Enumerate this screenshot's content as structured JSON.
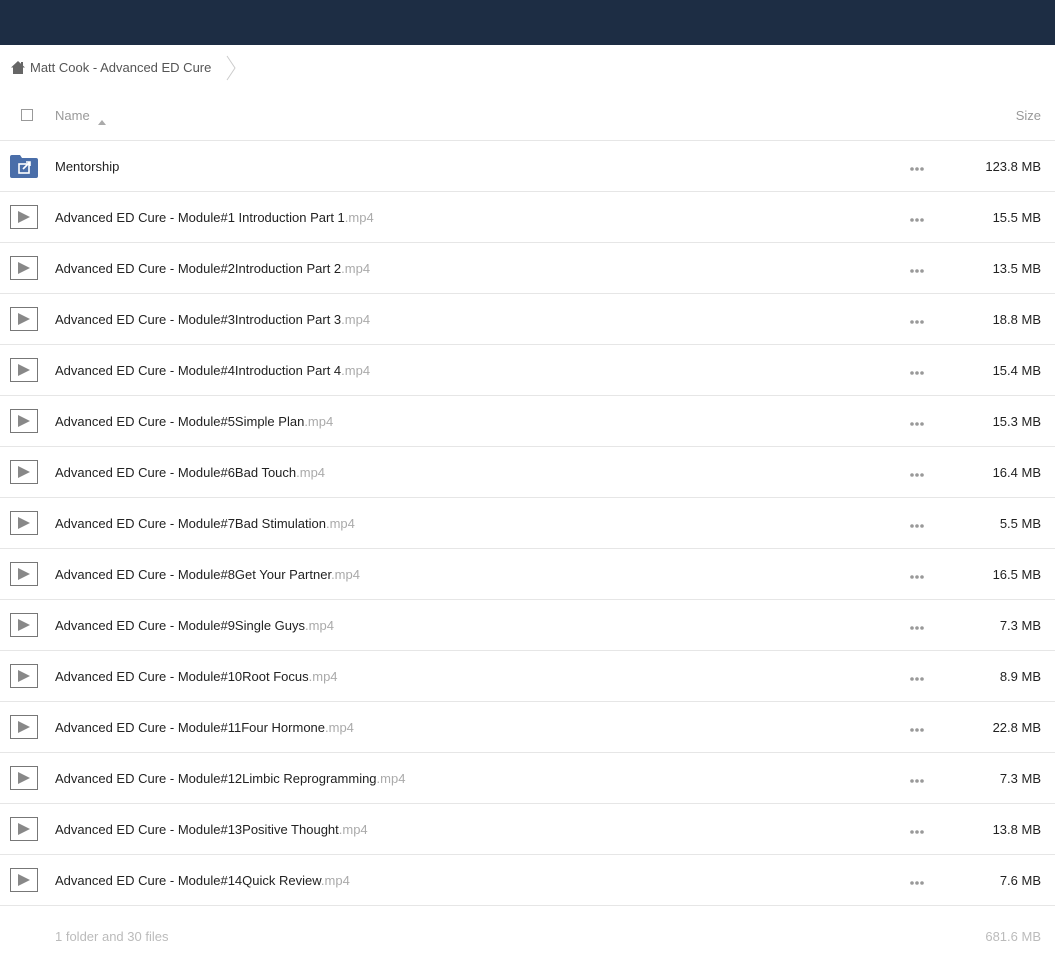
{
  "colors": {
    "topbar": "#1d2d44",
    "folder_icon": "#4a6ea9",
    "row_border": "#e6e6e6"
  },
  "breadcrumb": {
    "home_icon": "home-icon",
    "label": "Matt Cook - Advanced ED Cure"
  },
  "table": {
    "header": {
      "name": "Name",
      "size": "Size"
    },
    "rows": [
      {
        "type": "folder",
        "icon": "folder-shared-icon",
        "name": "Mentorship",
        "ext": "",
        "size": "123.8 MB"
      },
      {
        "type": "video",
        "icon": "video-icon",
        "name": "Advanced ED Cure - Module#1 Introduction Part 1",
        "ext": ".mp4",
        "size": "15.5 MB"
      },
      {
        "type": "video",
        "icon": "video-icon",
        "name": "Advanced ED Cure - Module#2Introduction Part 2",
        "ext": ".mp4",
        "size": "13.5 MB"
      },
      {
        "type": "video",
        "icon": "video-icon",
        "name": "Advanced ED Cure - Module#3Introduction Part 3",
        "ext": ".mp4",
        "size": "18.8 MB"
      },
      {
        "type": "video",
        "icon": "video-icon",
        "name": "Advanced ED Cure - Module#4Introduction Part 4",
        "ext": ".mp4",
        "size": "15.4 MB"
      },
      {
        "type": "video",
        "icon": "video-icon",
        "name": "Advanced ED Cure - Module#5Simple Plan",
        "ext": ".mp4",
        "size": "15.3 MB"
      },
      {
        "type": "video",
        "icon": "video-icon",
        "name": "Advanced ED Cure - Module#6Bad Touch",
        "ext": ".mp4",
        "size": "16.4 MB"
      },
      {
        "type": "video",
        "icon": "video-icon",
        "name": "Advanced ED Cure - Module#7Bad Stimulation",
        "ext": ".mp4",
        "size": "5.5 MB"
      },
      {
        "type": "video",
        "icon": "video-icon",
        "name": "Advanced ED Cure - Module#8Get Your Partner",
        "ext": ".mp4",
        "size": "16.5 MB"
      },
      {
        "type": "video",
        "icon": "video-icon",
        "name": "Advanced ED Cure - Module#9Single Guys",
        "ext": ".mp4",
        "size": "7.3 MB"
      },
      {
        "type": "video",
        "icon": "video-icon",
        "name": "Advanced ED Cure - Module#10Root Focus",
        "ext": ".mp4",
        "size": "8.9 MB"
      },
      {
        "type": "video",
        "icon": "video-icon",
        "name": "Advanced ED Cure - Module#11Four Hormone",
        "ext": ".mp4",
        "size": "22.8 MB"
      },
      {
        "type": "video",
        "icon": "video-icon",
        "name": "Advanced ED Cure - Module#12Limbic Reprogramming",
        "ext": ".mp4",
        "size": "7.3 MB"
      },
      {
        "type": "video",
        "icon": "video-icon",
        "name": "Advanced ED Cure - Module#13Positive Thought",
        "ext": ".mp4",
        "size": "13.8 MB"
      },
      {
        "type": "video",
        "icon": "video-icon",
        "name": "Advanced ED Cure - Module#14Quick Review",
        "ext": ".mp4",
        "size": "7.6 MB"
      }
    ]
  },
  "summary": {
    "text": "1 folder and 30 files",
    "total_size": "681.6 MB"
  }
}
